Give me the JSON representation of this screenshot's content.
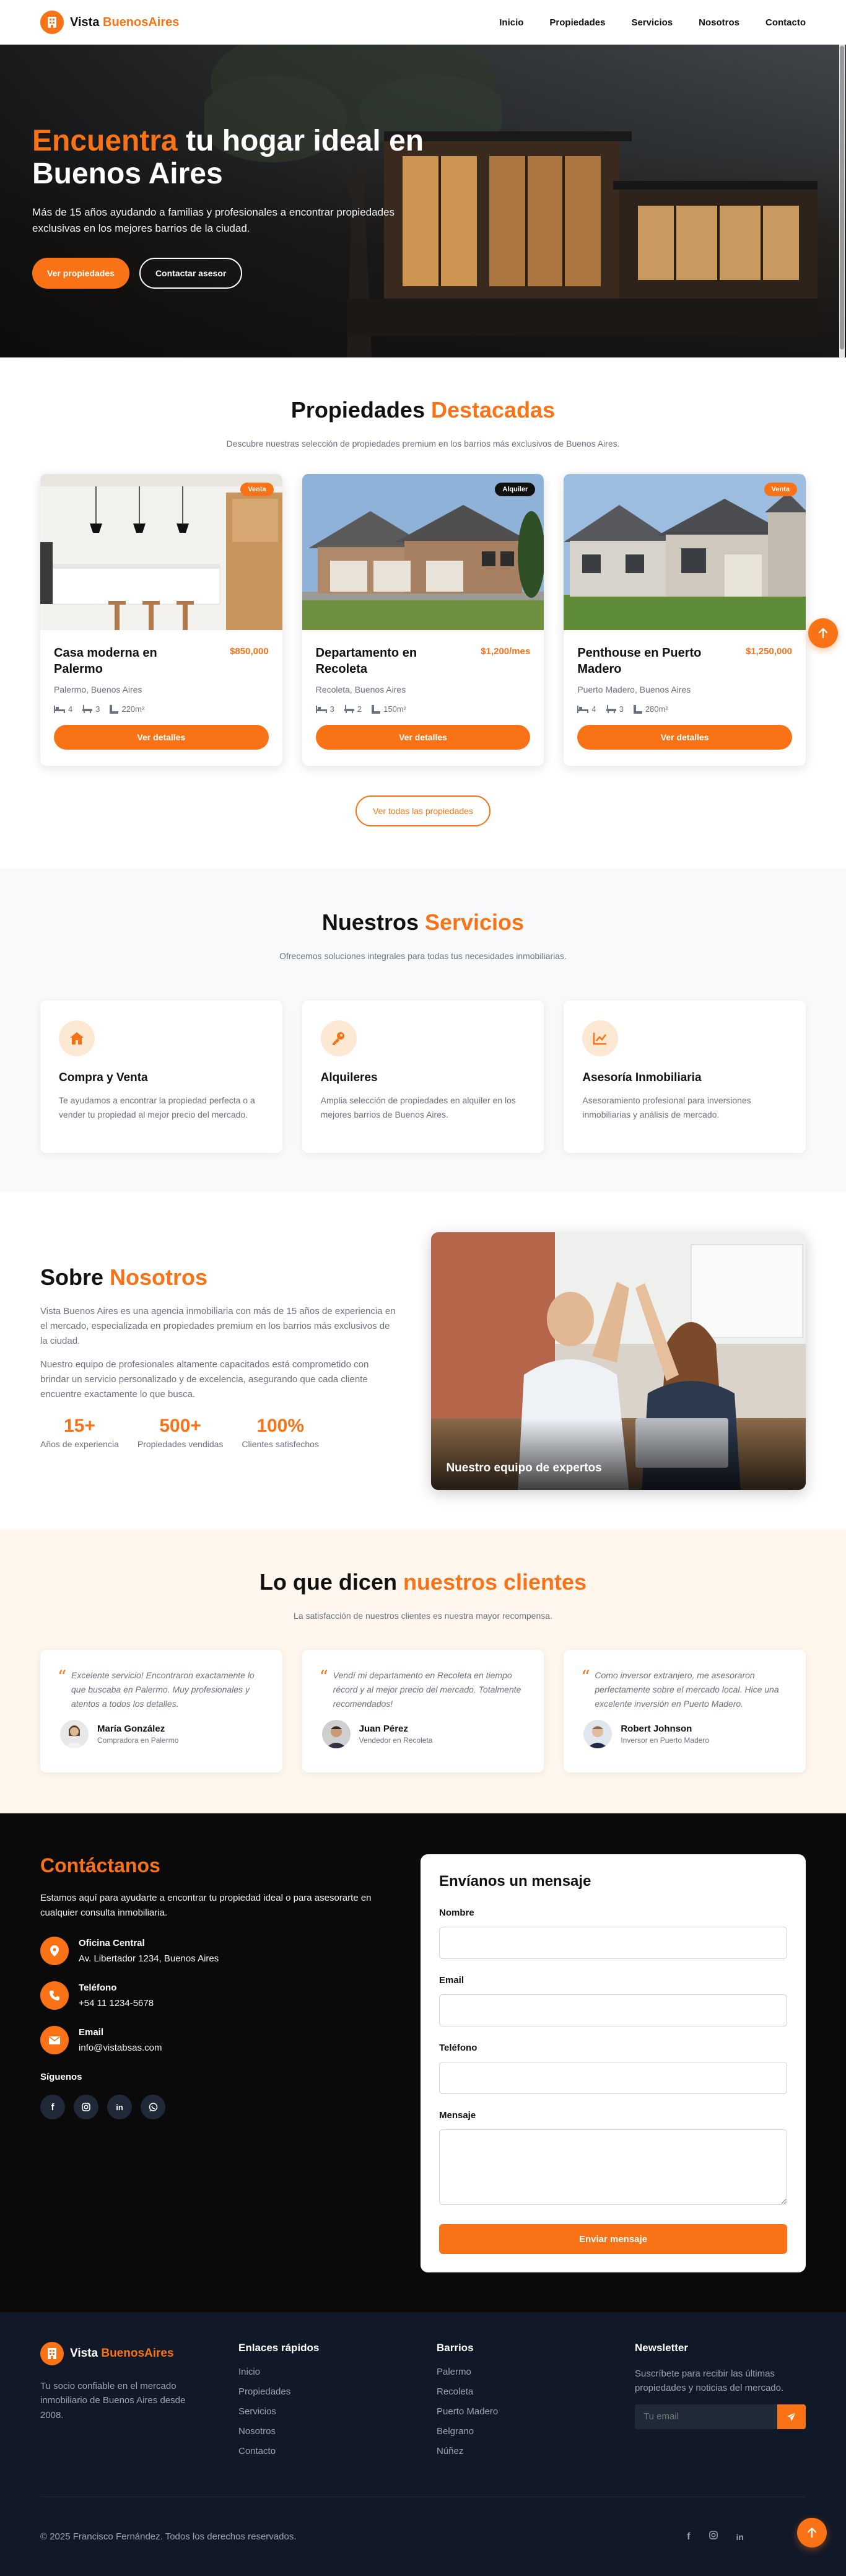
{
  "nav": {
    "brand_a": "Vista ",
    "brand_b": "BuenosAires",
    "links": [
      "Inicio",
      "Propiedades",
      "Servicios",
      "Nosotros",
      "Contacto"
    ]
  },
  "hero": {
    "title_a": "Encuentra",
    "title_b": " tu hogar ideal en Buenos Aires",
    "subtitle": "Más de 15 años ayudando a familias y profesionales a encontrar propiedades exclusivas en los mejores barrios de la ciudad.",
    "btn_primary": "Ver propiedades",
    "btn_secondary": "Contactar asesor"
  },
  "properties": {
    "title_a": "Propiedades ",
    "title_b": "Destacadas",
    "subtitle": "Descubre nuestras selección de propiedades premium en los barrios más exclusivos de Buenos Aires.",
    "items": [
      {
        "badge": "Venta",
        "badge_color": "#f97316",
        "title": "Casa moderna en Palermo",
        "price": "$850,000",
        "location": "Palermo, Buenos Aires",
        "beds": "4",
        "baths": "3",
        "area": "220m²",
        "button": "Ver detalles"
      },
      {
        "badge": "Alquiler",
        "badge_color": "#111111",
        "title": "Departamento en Recoleta",
        "price": "$1,200/mes",
        "location": "Recoleta, Buenos Aires",
        "beds": "3",
        "baths": "2",
        "area": "150m²",
        "button": "Ver detalles"
      },
      {
        "badge": "Venta",
        "badge_color": "#f97316",
        "title": "Penthouse en Puerto Madero",
        "price": "$1,250,000",
        "location": "Puerto Madero, Buenos Aires",
        "beds": "4",
        "baths": "3",
        "area": "280m²",
        "button": "Ver detalles"
      }
    ],
    "all_button": "Ver todas las propiedades"
  },
  "services": {
    "title_a": "Nuestros ",
    "title_b": "Servicios",
    "subtitle": "Ofrecemos soluciones integrales para todas tus necesidades inmobiliarias.",
    "items": [
      {
        "icon": "home-icon",
        "title": "Compra y Venta",
        "text": "Te ayudamos a encontrar la propiedad perfecta o a vender tu propiedad al mejor precio del mercado."
      },
      {
        "icon": "key-icon",
        "title": "Alquileres",
        "text": "Amplia selección de propiedades en alquiler en los mejores barrios de Buenos Aires."
      },
      {
        "icon": "chart-line-icon",
        "title": "Asesoría Inmobiliaria",
        "text": "Asesoramiento profesional para inversiones inmobiliarias y análisis de mercado."
      }
    ]
  },
  "about": {
    "title_a": "Sobre ",
    "title_b": "Nosotros",
    "p1": "Vista Buenos Aires es una agencia inmobiliaria con más de 15 años de experiencia en el mercado, especializada en propiedades premium en los barrios más exclusivos de la ciudad.",
    "p2": "Nuestro equipo de profesionales altamente capacitados está comprometido con brindar un servicio personalizado y de excelencia, asegurando que cada cliente encuentre exactamente lo que busca.",
    "stats": [
      {
        "num": "15+",
        "label": "Años de experiencia"
      },
      {
        "num": "500+",
        "label": "Propiedades vendidas"
      },
      {
        "num": "100%",
        "label": "Clientes satisfechos"
      }
    ],
    "caption": "Nuestro equipo de expertos"
  },
  "testimonials": {
    "title_a": "Lo que dicen ",
    "title_b": "nuestros clientes",
    "subtitle": "La satisfacción de nuestros clientes es nuestra mayor recompensa.",
    "items": [
      {
        "quote": "Excelente servicio! Encontraron exactamente lo que buscaba en Palermo. Muy profesionales y atentos a todos los detalles.",
        "name": "María González",
        "role": "Compradora en Palermo"
      },
      {
        "quote": "Vendí mi departamento en Recoleta en tiempo récord y al mejor precio del mercado. Totalmente recomendados!",
        "name": "Juan Pérez",
        "role": "Vendedor en Recoleta"
      },
      {
        "quote": "Como inversor extranjero, me asesoraron perfectamente sobre el mercado local. Hice una excelente inversión en Puerto Madero.",
        "name": "Robert Johnson",
        "role": "Inversor en Puerto Madero"
      }
    ]
  },
  "contact": {
    "title": "Contáctanos",
    "intro": "Estamos aquí para ayudarte a encontrar tu propiedad ideal o para asesorarte en cualquier consulta inmobiliaria.",
    "info": [
      {
        "icon": "map-pin-icon",
        "title": "Oficina Central",
        "value": "Av. Libertador 1234, Buenos Aires"
      },
      {
        "icon": "phone-icon",
        "title": "Teléfono",
        "value": "+54 11 1234-5678"
      },
      {
        "icon": "envelope-icon",
        "title": "Email",
        "value": "info@vistabsas.com"
      }
    ],
    "follow": "Síguenos",
    "form": {
      "title": "Envíanos un mensaje",
      "name_label": "Nombre",
      "email_label": "Email",
      "phone_label": "Teléfono",
      "message_label": "Mensaje",
      "submit": "Enviar mensaje"
    }
  },
  "footer": {
    "brand_desc": "Tu socio confiable en el mercado inmobiliario de Buenos Aires desde 2008.",
    "links_title": "Enlaces rápidos",
    "links": [
      "Inicio",
      "Propiedades",
      "Servicios",
      "Nosotros",
      "Contacto"
    ],
    "barrios_title": "Barrios",
    "barrios": [
      "Palermo",
      "Recoleta",
      "Puerto Madero",
      "Belgrano",
      "Núñez"
    ],
    "newsletter_title": "Newsletter",
    "newsletter_desc": "Suscríbete para recibir las últimas propiedades y noticias del mercado.",
    "newsletter_placeholder": "Tu email",
    "copyright": "© 2025 Francisco Fernández. Todos los derechos reservados."
  },
  "colors": {
    "accent": "#f97316",
    "dark": "#0a0a0a",
    "footer": "#111827"
  }
}
